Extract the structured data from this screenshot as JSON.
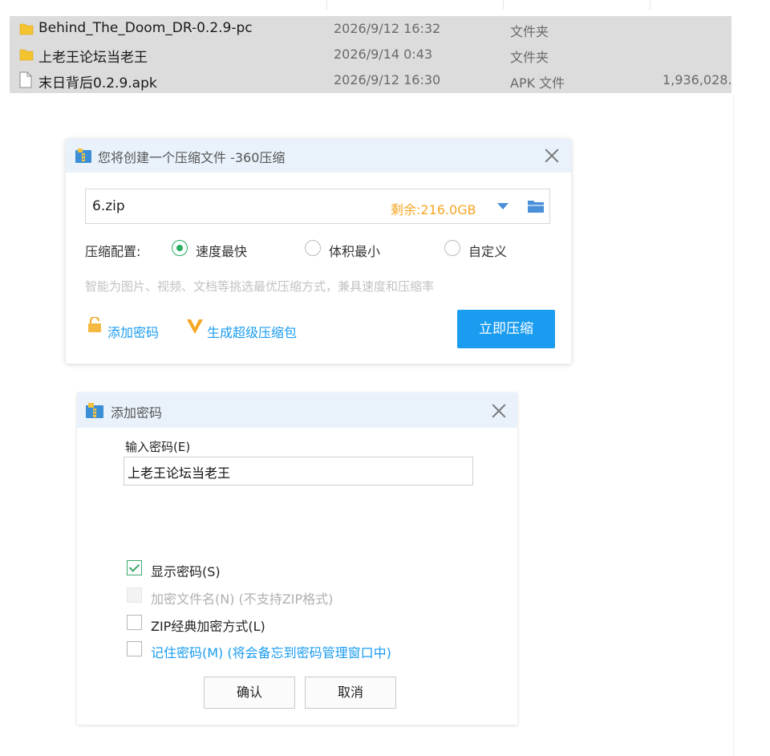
{
  "file_list": {
    "rows": [
      {
        "name": "Behind_The_Doom_DR-0.2.9-pc",
        "modified": "2026/9/12 16:32",
        "type": "文件夹",
        "size": "",
        "icon": "folder-icon"
      },
      {
        "name": "上老王论坛当老王",
        "modified": "2026/9/14 0:43",
        "type": "文件夹",
        "size": "",
        "icon": "folder-icon"
      },
      {
        "name": "末日背后0.2.9.apk",
        "modified": "2026/9/12 16:30",
        "type": "APK 文件",
        "size": "1,936,028.",
        "icon": "file-icon"
      }
    ]
  },
  "compress_dialog": {
    "title": "您将创建一个压缩文件 -360压缩",
    "filename": "6.zip",
    "remaining": "剩余:216.0GB",
    "config_label": "压缩配置:",
    "options": [
      {
        "label": "速度最快",
        "selected": true
      },
      {
        "label": "体积最小",
        "selected": false
      },
      {
        "label": "自定义",
        "selected": false
      }
    ],
    "hint": "智能为图片、视频、文档等挑选最优压缩方式，兼具速度和压缩率",
    "add_password": "添加密码",
    "super_package": "生成超级压缩包",
    "compress_now": "立即压缩",
    "colors": {
      "accent": "#1a9cf0",
      "orange": "#f5a623",
      "green": "#27ae60"
    }
  },
  "password_dialog": {
    "title": "添加密码",
    "input_label": "输入密码(E)",
    "password_value": "上老王论坛当老王",
    "checkboxes": [
      {
        "label": "显示密码(S)",
        "checked": true,
        "disabled": false
      },
      {
        "label": "加密文件名(N) (不支持ZIP格式)",
        "checked": false,
        "disabled": true
      },
      {
        "label": "ZIP经典加密方式(L)",
        "checked": false,
        "disabled": false
      },
      {
        "label": "记住密码(M) (将会备忘到密码管理窗口中)",
        "checked": false,
        "disabled": false
      }
    ],
    "ok": "确认",
    "cancel": "取消"
  }
}
